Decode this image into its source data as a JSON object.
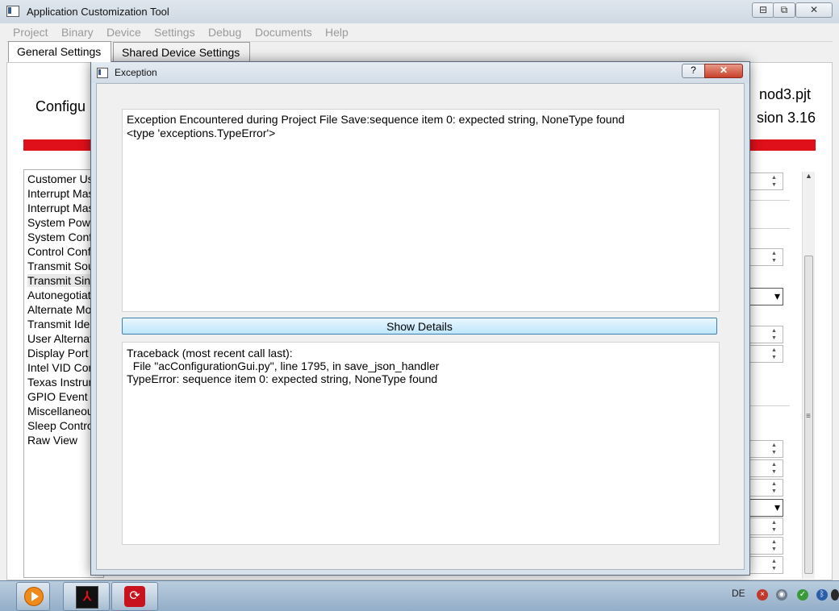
{
  "window": {
    "title": "Application Customization Tool",
    "minimize_glyph": "⊟",
    "maximize_glyph": "⧉",
    "close_glyph": "✕"
  },
  "menu": [
    "Project",
    "Binary",
    "Device",
    "Settings",
    "Debug",
    "Documents",
    "Help"
  ],
  "tabs": [
    {
      "label": "General Settings",
      "active": true
    },
    {
      "label": "Shared Device Settings",
      "active": false
    }
  ],
  "header": {
    "config_title": "Configu",
    "project_file": "nod3.pjt",
    "version": "sion 3.16"
  },
  "nav_items": [
    "Customer Us",
    "Interrupt Mas",
    "Interrupt Mas",
    "System Powe",
    "System Conf",
    "Control Conf",
    "Transmit Sou",
    "Transmit Sin",
    "Autonegotiat",
    "Alternate Mo",
    "Transmit Ide",
    "User Alternat",
    "Display Port",
    "Intel VID Cor",
    "Texas Instrum",
    "GPIO Event",
    "Miscellaneou",
    "Sleep Contro",
    "Raw View"
  ],
  "dialog": {
    "title": "Exception",
    "help_glyph": "?",
    "close_glyph": "✕",
    "message_lines": [
      "Exception Encountered during Project File Save:sequence item 0: expected string, NoneType found",
      "<type 'exceptions.TypeError'>"
    ],
    "show_details_label": "Show Details",
    "traceback_lines": [
      "Traceback (most recent call last):",
      "  File \"acConfigurationGui.py\", line 1795, in save_json_handler",
      "TypeError: sequence item 0: expected string, NoneType found"
    ]
  },
  "taskbar": {
    "language": "DE",
    "pdf_glyph": "⅄",
    "reader_glyph": "⟳"
  },
  "colors": {
    "accent_red": "#e0101a",
    "button_blue": "#bee6fd"
  }
}
